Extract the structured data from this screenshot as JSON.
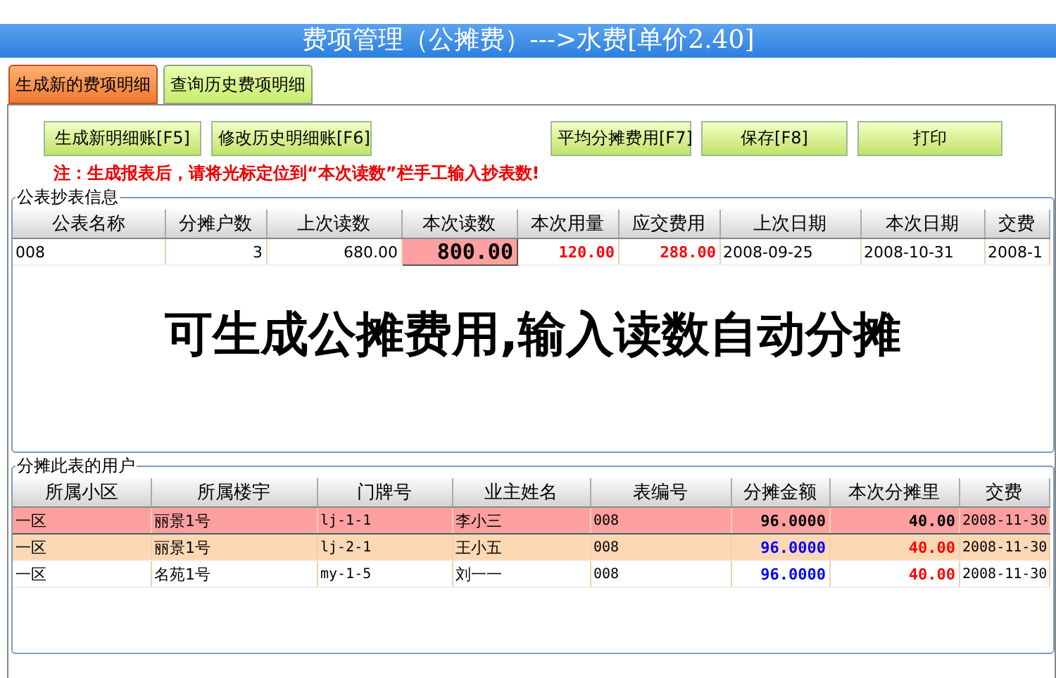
{
  "title": "费项管理（公摊费）--->水费[单价2.40]",
  "tabs": [
    {
      "label": "生成新的费项明细",
      "selected": true
    },
    {
      "label": "查询历史费项明细",
      "selected": false
    }
  ],
  "button_groups": [
    [
      "生成新明细账[F5]",
      "修改历史明细账[F6]"
    ],
    [
      "平均分摊费用[F7]",
      "保存[F8]",
      "打印"
    ]
  ],
  "note": "注：生成报表后，请将光标定位到“本次读数”栏手工输入抄表数!",
  "meter_group": {
    "title": "公表抄表信息",
    "columns": [
      {
        "label": "公表名称",
        "kind": "text"
      },
      {
        "label": "分摊户数",
        "kind": "num"
      },
      {
        "label": "上次读数",
        "kind": "num"
      },
      {
        "label": "本次读数",
        "kind": "input"
      },
      {
        "label": "本次用量",
        "kind": "red"
      },
      {
        "label": "应交费用",
        "kind": "red"
      },
      {
        "label": "上次日期",
        "kind": "text"
      },
      {
        "label": "本次日期",
        "kind": "text"
      },
      {
        "label": "交费",
        "kind": "text"
      }
    ],
    "rows": [
      {
        "cells": [
          "008",
          "3",
          "680.00",
          "800.00",
          "120.00",
          "288.00",
          "2008-09-25",
          "2008-10-31",
          "2008-1"
        ]
      }
    ]
  },
  "overlay_text": "可生成公摊费用,输入读数自动分摊",
  "users_group": {
    "title": "分摊此表的用户",
    "columns": [
      {
        "label": "所属小区",
        "kind": "text"
      },
      {
        "label": "所属楼宇",
        "kind": "text"
      },
      {
        "label": "门牌号",
        "kind": "mono"
      },
      {
        "label": "业主姓名",
        "kind": "text"
      },
      {
        "label": "表编号",
        "kind": "mono"
      },
      {
        "label": "分摊金额",
        "kind": "blue"
      },
      {
        "label": "本次分摊里",
        "kind": "red"
      },
      {
        "label": "交费",
        "kind": "mono"
      }
    ],
    "rows": [
      {
        "selected": true,
        "shaded": true,
        "cells": [
          "一区",
          "丽景1号",
          "lj-1-1",
          "李小三",
          "008",
          "96.0000",
          "40.00",
          "2008-11-30"
        ]
      },
      {
        "selected": false,
        "shaded": true,
        "cells": [
          "一区",
          "丽景1号",
          "lj-2-1",
          "王小五",
          "008",
          "96.0000",
          "40.00",
          "2008-11-30"
        ]
      },
      {
        "selected": false,
        "shaded": false,
        "cells": [
          "一区",
          "名苑1号",
          "my-1-5",
          "刘一一",
          "008",
          "96.0000",
          "40.00",
          "2008-11-30"
        ]
      }
    ]
  }
}
